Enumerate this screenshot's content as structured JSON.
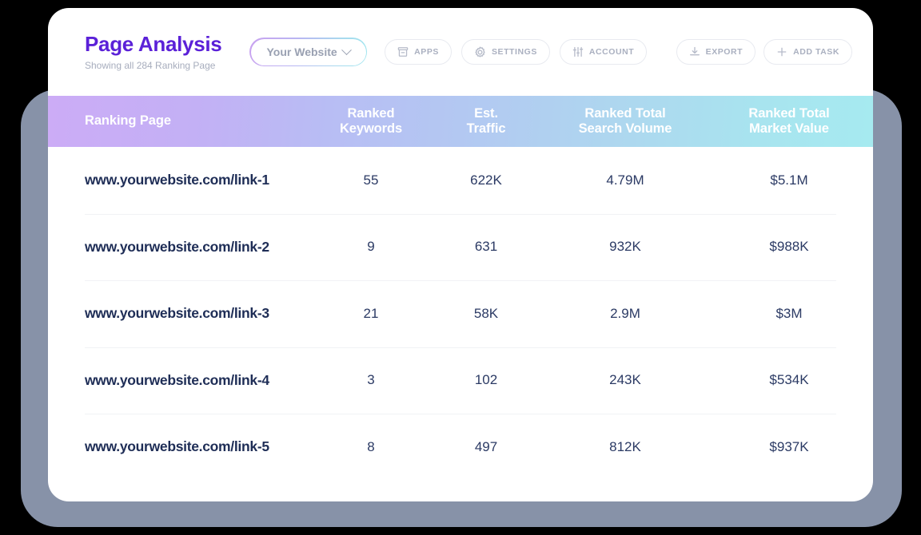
{
  "header": {
    "title": "Page Analysis",
    "subtitle": "Showing all 284 Ranking Page",
    "site_dropdown": {
      "label": "Your Website",
      "icon": "chevron-down-icon"
    },
    "toolbar_left": [
      {
        "label": "APPS",
        "icon": "apps-box-icon"
      },
      {
        "label": "SETTINGS",
        "icon": "gear-icon"
      },
      {
        "label": "ACCOUNT",
        "icon": "sliders-icon"
      }
    ],
    "toolbar_right": [
      {
        "label": "EXPORT",
        "icon": "download-icon"
      },
      {
        "label": "ADD TASK",
        "icon": "plus-icon"
      }
    ]
  },
  "colors": {
    "title": "#5b21d8",
    "subtitle": "#a7adbd",
    "header_gradient_start": "#ccacf6",
    "header_gradient_mid": "#b3c8f2",
    "header_gradient_end": "#a6eaf0",
    "cell_text": "#2b3a64",
    "backdrop": "#8792a8",
    "pill_border": "#e8eaf0",
    "pill_label": "#aab0c0",
    "row_divider": "#f1f2f5"
  },
  "table": {
    "columns": [
      "Ranking Page",
      "Ranked\nKeywords",
      "Est.\nTraffic",
      "Ranked Total\nSearch Volume",
      "Ranked Total\nMarket Value"
    ],
    "columns_split": [
      {
        "line1": "Ranking Page",
        "line2": ""
      },
      {
        "line1": "Ranked",
        "line2": "Keywords"
      },
      {
        "line1": "Est.",
        "line2": "Traffic"
      },
      {
        "line1": "Ranked Total",
        "line2": "Search Volume"
      },
      {
        "line1": "Ranked Total",
        "line2": "Market Value"
      }
    ],
    "rows": [
      {
        "page": "www.yourwebsite.com/link-1",
        "ranked_keywords": "55",
        "est_traffic": "622K",
        "ranked_total_search_volume": "4.79M",
        "ranked_total_market_value": "$5.1M"
      },
      {
        "page": "www.yourwebsite.com/link-2",
        "ranked_keywords": "9",
        "est_traffic": "631",
        "ranked_total_search_volume": "932K",
        "ranked_total_market_value": "$988K"
      },
      {
        "page": "www.yourwebsite.com/link-3",
        "ranked_keywords": "21",
        "est_traffic": "58K",
        "ranked_total_search_volume": "2.9M",
        "ranked_total_market_value": "$3M"
      },
      {
        "page": "www.yourwebsite.com/link-4",
        "ranked_keywords": "3",
        "est_traffic": "102",
        "ranked_total_search_volume": "243K",
        "ranked_total_market_value": "$534K"
      },
      {
        "page": "www.yourwebsite.com/link-5",
        "ranked_keywords": "8",
        "est_traffic": "497",
        "ranked_total_search_volume": "812K",
        "ranked_total_market_value": "$937K"
      }
    ]
  }
}
